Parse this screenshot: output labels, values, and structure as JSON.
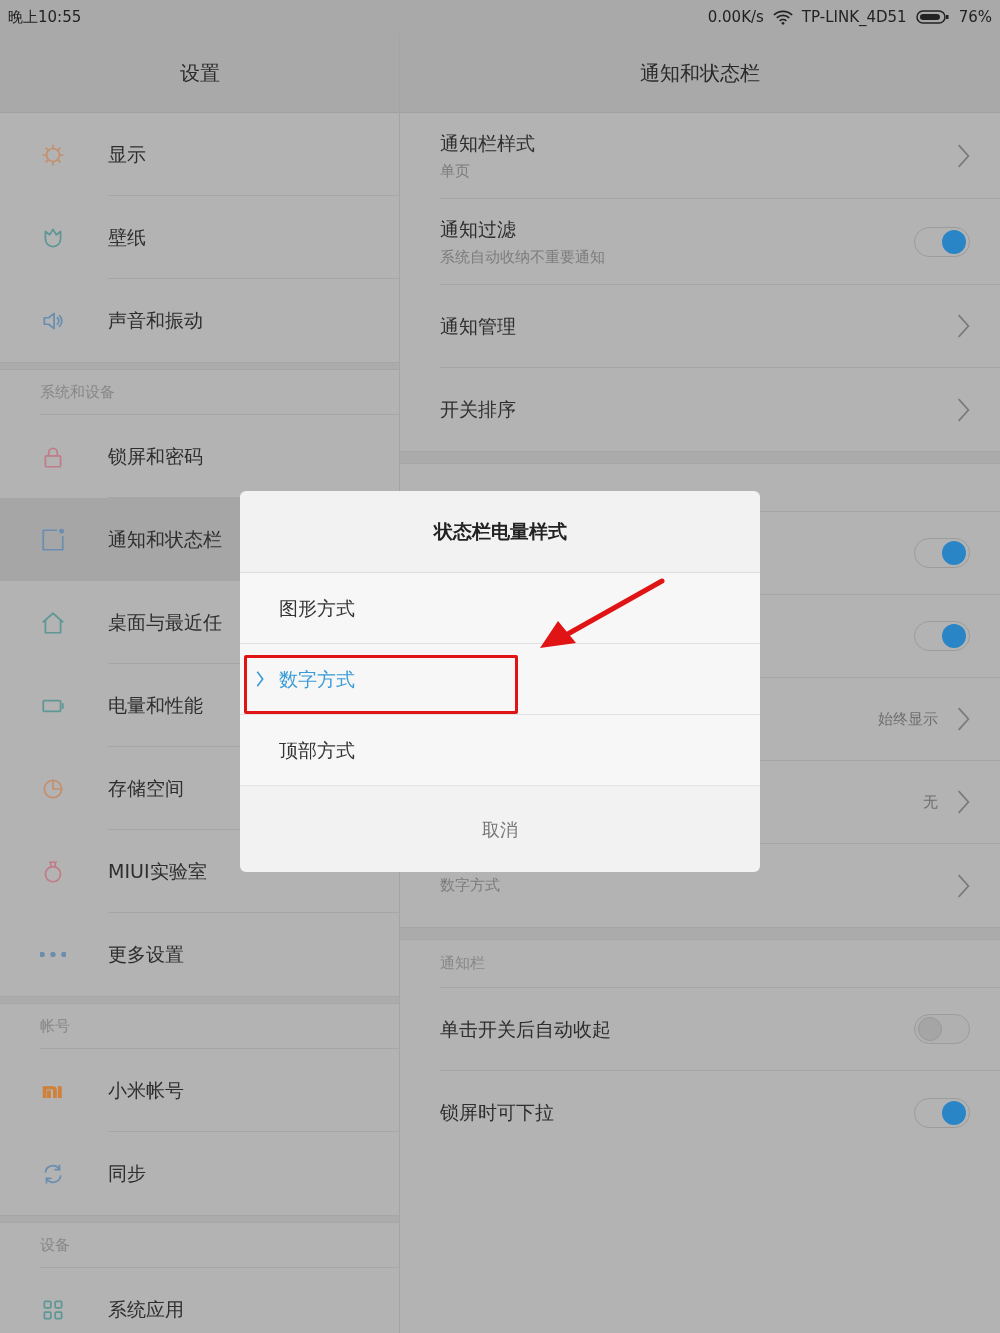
{
  "status_bar": {
    "time": "晚上10:55",
    "speed": "0.00K/s",
    "network": "TP-LINK_4D51",
    "battery": "76%"
  },
  "left_panel": {
    "title": "设置",
    "sections": [
      {
        "items": [
          {
            "label": "显示",
            "selected": false
          },
          {
            "label": "壁纸",
            "selected": false
          },
          {
            "label": "声音和振动",
            "selected": false
          }
        ]
      },
      {
        "header": "系统和设备",
        "items": [
          {
            "label": "锁屏和密码",
            "selected": false
          },
          {
            "label": "通知和状态栏",
            "selected": true
          },
          {
            "label": "桌面与最近任",
            "selected": false
          },
          {
            "label": "电量和性能",
            "selected": false
          },
          {
            "label": "存储空间",
            "selected": false
          },
          {
            "label": "MIUI实验室",
            "selected": false
          },
          {
            "label": "更多设置",
            "selected": false
          }
        ]
      },
      {
        "header": "帐号",
        "items": [
          {
            "label": "小米帐号",
            "selected": false
          },
          {
            "label": "同步",
            "selected": false
          }
        ]
      },
      {
        "header": "设备",
        "items": [
          {
            "label": "系统应用",
            "selected": false
          }
        ]
      }
    ]
  },
  "right_panel": {
    "title": "通知和状态栏",
    "sections": [
      {
        "rows": [
          {
            "kind": "link",
            "title": "通知栏样式",
            "subtitle": "单页"
          },
          {
            "kind": "toggle",
            "title": "通知过滤",
            "subtitle": "系统自动收纳不重要通知",
            "on": true
          },
          {
            "kind": "link",
            "title": "通知管理"
          },
          {
            "kind": "link",
            "title": "开关排序"
          }
        ]
      },
      {
        "rows": [
          {
            "kind": "toggle",
            "on": true
          },
          {
            "kind": "toggle",
            "on": true
          },
          {
            "kind": "link",
            "value": "始终显示"
          },
          {
            "kind": "link",
            "value": "无"
          },
          {
            "kind": "link",
            "subtitle": "数字方式"
          }
        ]
      },
      {
        "header": "通知栏",
        "rows": [
          {
            "kind": "toggle",
            "title": "单击开关后自动收起",
            "on": false
          },
          {
            "kind": "toggle",
            "title": "锁屏时可下拉",
            "on": true
          }
        ]
      }
    ]
  },
  "dialog": {
    "title": "状态栏电量样式",
    "options": [
      {
        "label": "图形方式",
        "selected": false
      },
      {
        "label": "数字方式",
        "selected": true
      },
      {
        "label": "顶部方式",
        "selected": false
      }
    ],
    "cancel": "取消"
  }
}
